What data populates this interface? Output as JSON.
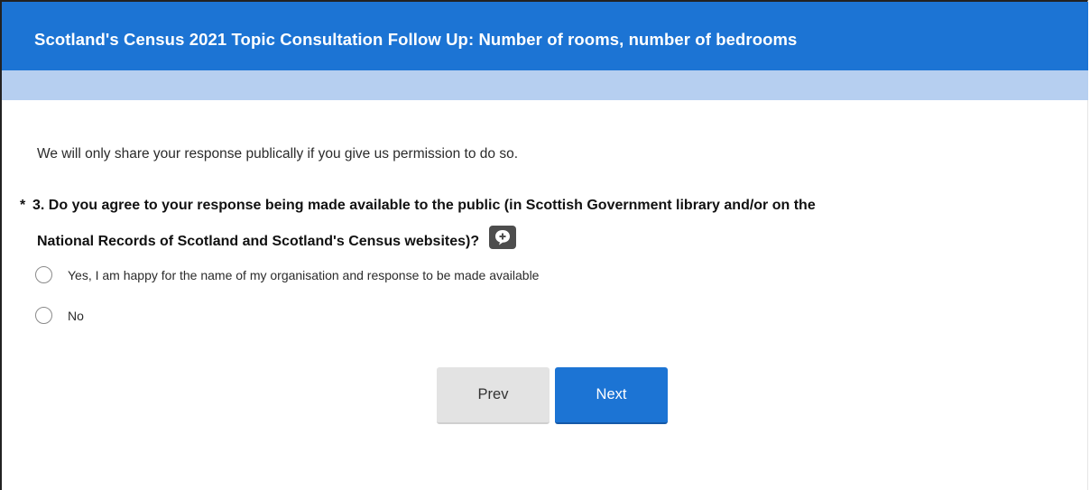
{
  "survey": {
    "title": "Scotland's Census 2021 Topic Consultation Follow Up: Number of rooms, number of bedrooms"
  },
  "intro": {
    "text": "We will only share your response publically if you give us permission to do so."
  },
  "question": {
    "required_marker": "*",
    "line1": "3. Do you agree to your response being made available to the public (in Scottish Government library and/or on the",
    "line2": "National Records of Scotland and Scotland's Census websites)?",
    "comment_icon": "comment-plus-icon",
    "options": [
      {
        "label": "Yes, I am happy for the name of my organisation and response to be made available",
        "selected": false
      },
      {
        "label": "No",
        "selected": false
      }
    ]
  },
  "nav": {
    "prev_label": "Prev",
    "next_label": "Next"
  },
  "colors": {
    "header_blue": "#1c74d4",
    "progress_band": "#b6cff0",
    "prev_button": "#e3e3e3",
    "next_button": "#1c74d4"
  }
}
